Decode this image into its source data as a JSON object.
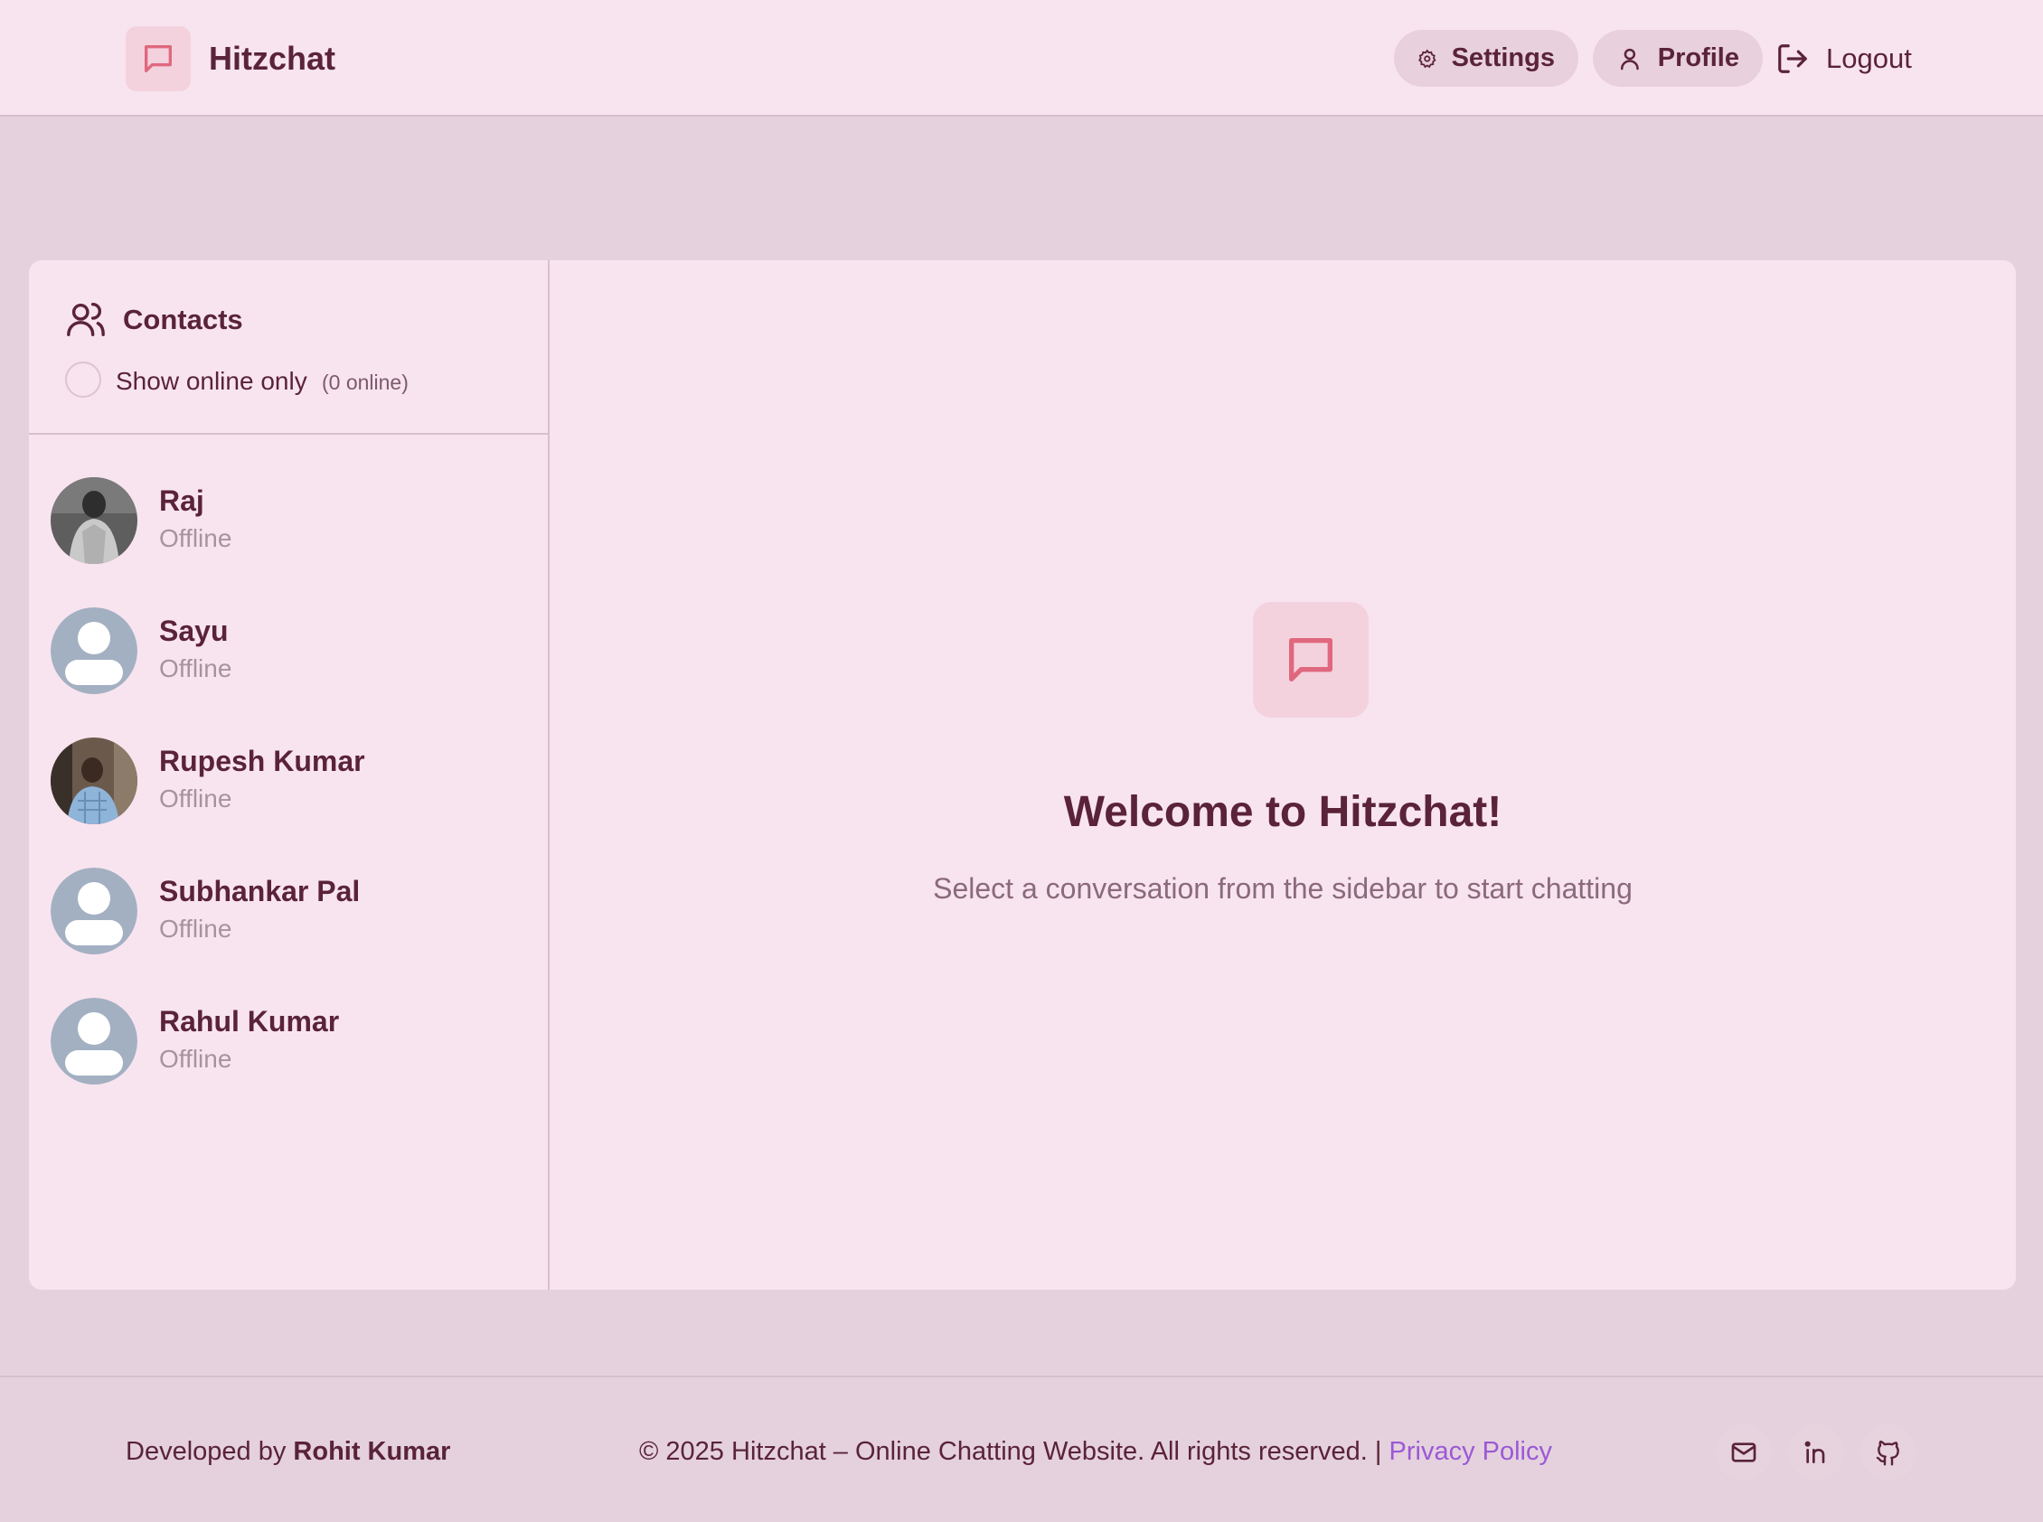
{
  "header": {
    "app_title": "Hitzchat",
    "settings_label": "Settings",
    "profile_label": "Profile",
    "logout_label": "Logout"
  },
  "sidebar": {
    "title": "Contacts",
    "online_filter_label": "Show online only",
    "online_count": "(0 online)",
    "contacts": [
      {
        "name": "Raj",
        "status": "Offline",
        "avatar": "photo"
      },
      {
        "name": "Sayu",
        "status": "Offline",
        "avatar": "default-user-icon"
      },
      {
        "name": "Rupesh Kumar",
        "status": "Offline",
        "avatar": "photo"
      },
      {
        "name": "Subhankar Pal",
        "status": "Offline",
        "avatar": "default-user-icon"
      },
      {
        "name": "Rahul Kumar",
        "status": "Offline",
        "avatar": "default-user-icon"
      }
    ]
  },
  "main": {
    "welcome_title": "Welcome to Hitzchat!",
    "welcome_subtitle": "Select a conversation from the sidebar to start chatting"
  },
  "footer": {
    "developed_by_prefix": "Developed by ",
    "developer_name": "Rohit Kumar",
    "copyright": "© 2025 Hitzchat – Online Chatting Website. All rights reserved. | ",
    "privacy_label": "Privacy Policy",
    "social_icons": [
      "mail-icon",
      "linkedin-icon",
      "github-icon"
    ]
  },
  "colors": {
    "brand": "#5a2338",
    "accent_icon": "#e0687e",
    "link": "#9b59d6",
    "muted": "#a6939d"
  }
}
